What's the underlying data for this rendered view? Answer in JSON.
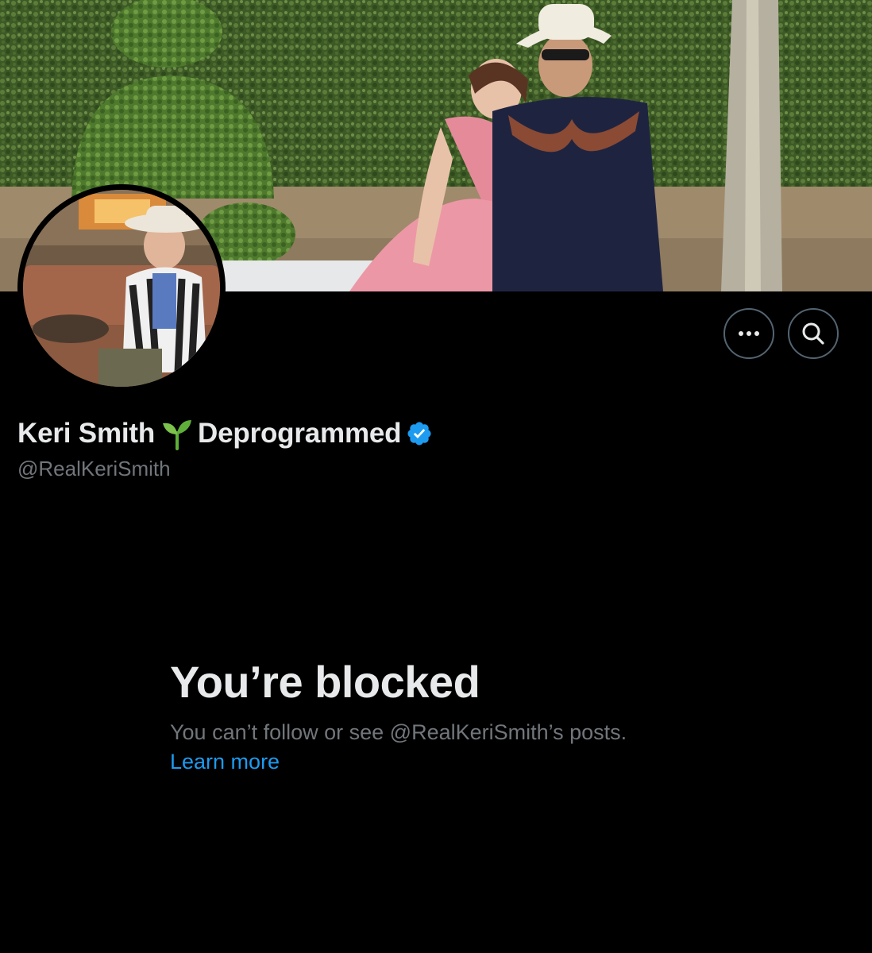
{
  "profile": {
    "display_name_first": "Keri Smith",
    "display_name_second": "Deprogrammed",
    "name_emoji_icon": "seedling-icon",
    "verified_icon": "verified-badge-icon",
    "handle": "@RealKeriSmith"
  },
  "actions": {
    "more_icon": "more-options-icon",
    "search_icon": "search-icon"
  },
  "blocked": {
    "title": "You’re blocked",
    "description": "You can’t follow or see @RealKeriSmith’s posts.",
    "learn_more": "Learn more"
  },
  "colors": {
    "background": "#000000",
    "primary_text": "#e7e9ea",
    "secondary_text": "#71767b",
    "link": "#1d9bf0",
    "verified": "#1d9bf0",
    "button_border": "#536471"
  }
}
